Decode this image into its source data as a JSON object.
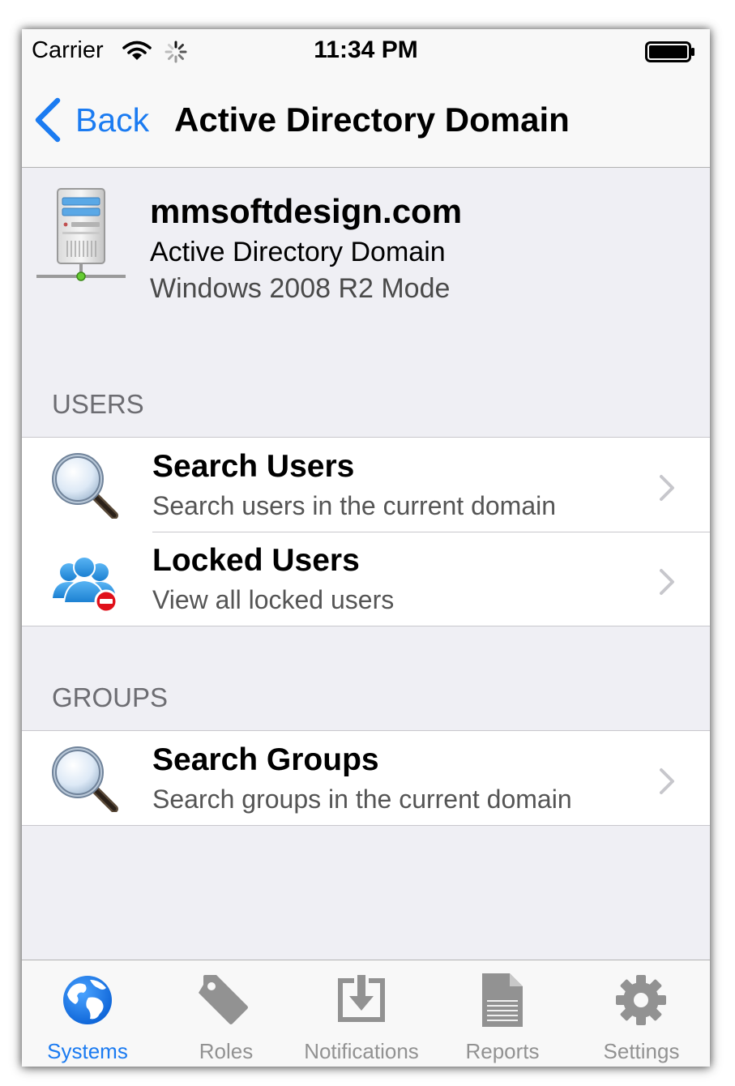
{
  "status_bar": {
    "carrier": "Carrier",
    "time": "11:34 PM"
  },
  "nav": {
    "back_label": "Back",
    "title": "Active Directory Domain"
  },
  "domain": {
    "name": "mmsoftdesign.com",
    "type": "Active Directory Domain",
    "mode": "Windows 2008 R2 Mode"
  },
  "sections": {
    "users": {
      "header": "USERS",
      "items": [
        {
          "title": "Search Users",
          "subtitle": "Search users in the current domain",
          "icon": "magnifier-icon"
        },
        {
          "title": "Locked Users",
          "subtitle": "View all locked users",
          "icon": "locked-users-icon"
        }
      ]
    },
    "groups": {
      "header": "GROUPS",
      "items": [
        {
          "title": "Search Groups",
          "subtitle": "Search groups in the current domain",
          "icon": "magnifier-icon"
        }
      ]
    }
  },
  "tab_bar": {
    "selected": "Systems",
    "tabs": [
      {
        "label": "Systems",
        "icon": "globe-icon"
      },
      {
        "label": "Roles",
        "icon": "tag-icon"
      },
      {
        "label": "Notifications",
        "icon": "inbox-download-icon"
      },
      {
        "label": "Reports",
        "icon": "document-icon"
      },
      {
        "label": "Settings",
        "icon": "gear-icon"
      }
    ]
  },
  "colors": {
    "accent": "#1b7bf1",
    "background": "#efeff4",
    "inactive_tab": "#929292",
    "badge_red": "#e0101a"
  }
}
